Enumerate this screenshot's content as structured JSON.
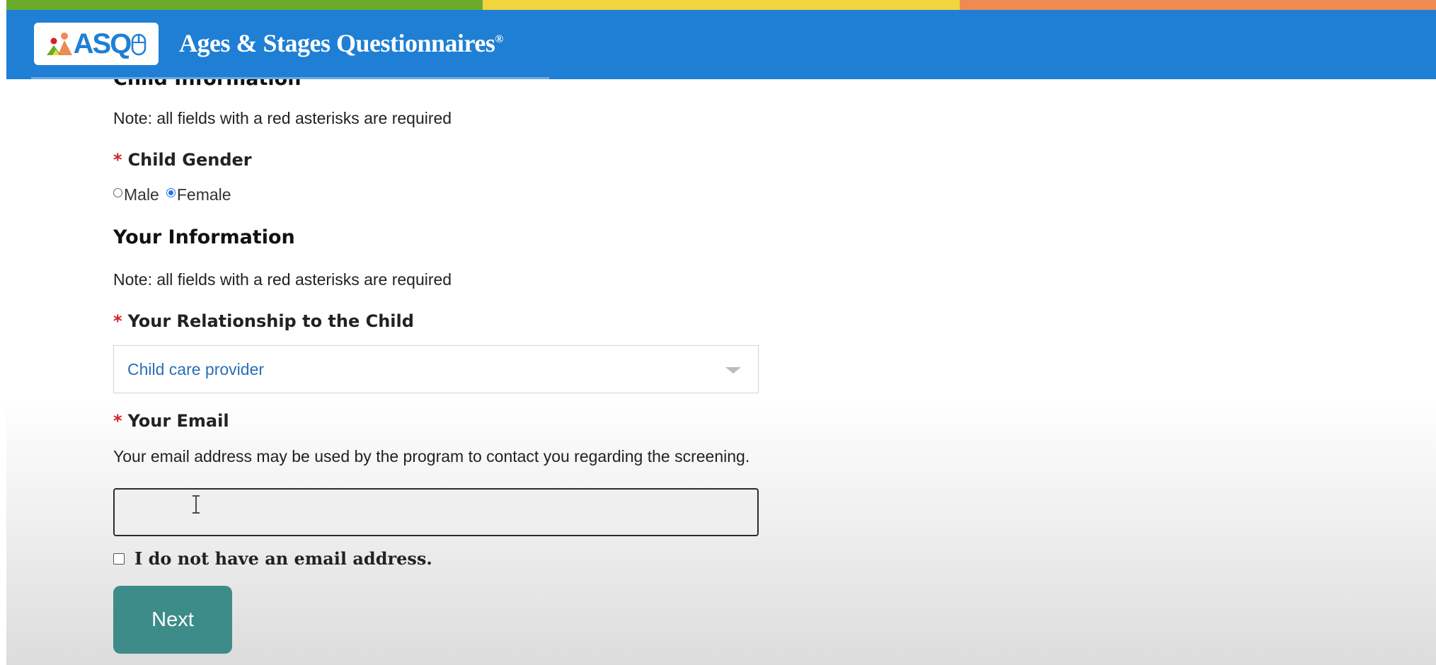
{
  "header": {
    "logo_text": "ASQ",
    "title": "Ages & Stages Questionnaires",
    "registered_mark": "®",
    "stripe_colors": [
      "#6aab2e",
      "#f2d43c",
      "#ee8a52"
    ],
    "background_color": "#1e7fd4"
  },
  "child_section": {
    "heading": "Child Information",
    "note": "Note: all fields with a red asterisks are required",
    "gender": {
      "required_mark": "*",
      "label": "Child Gender",
      "options": [
        {
          "label": "Male",
          "checked": false
        },
        {
          "label": "Female",
          "checked": true
        }
      ]
    }
  },
  "your_section": {
    "heading": "Your Information",
    "note": "Note: all fields with a red asterisks are required",
    "relationship": {
      "required_mark": "*",
      "label": "Your Relationship to the Child",
      "selected_value": "Child care provider"
    },
    "email": {
      "required_mark": "*",
      "label": "Your Email",
      "description": "Your email address may be used by the program to contact you regarding the screening.",
      "value": "",
      "placeholder": ""
    },
    "no_email": {
      "label": "I do not have an email address.",
      "checked": false
    }
  },
  "actions": {
    "next_label": "Next",
    "next_color": "#3d8c89"
  },
  "colors": {
    "required_asterisk": "#d2202a",
    "select_text": "#2a6fb7"
  }
}
